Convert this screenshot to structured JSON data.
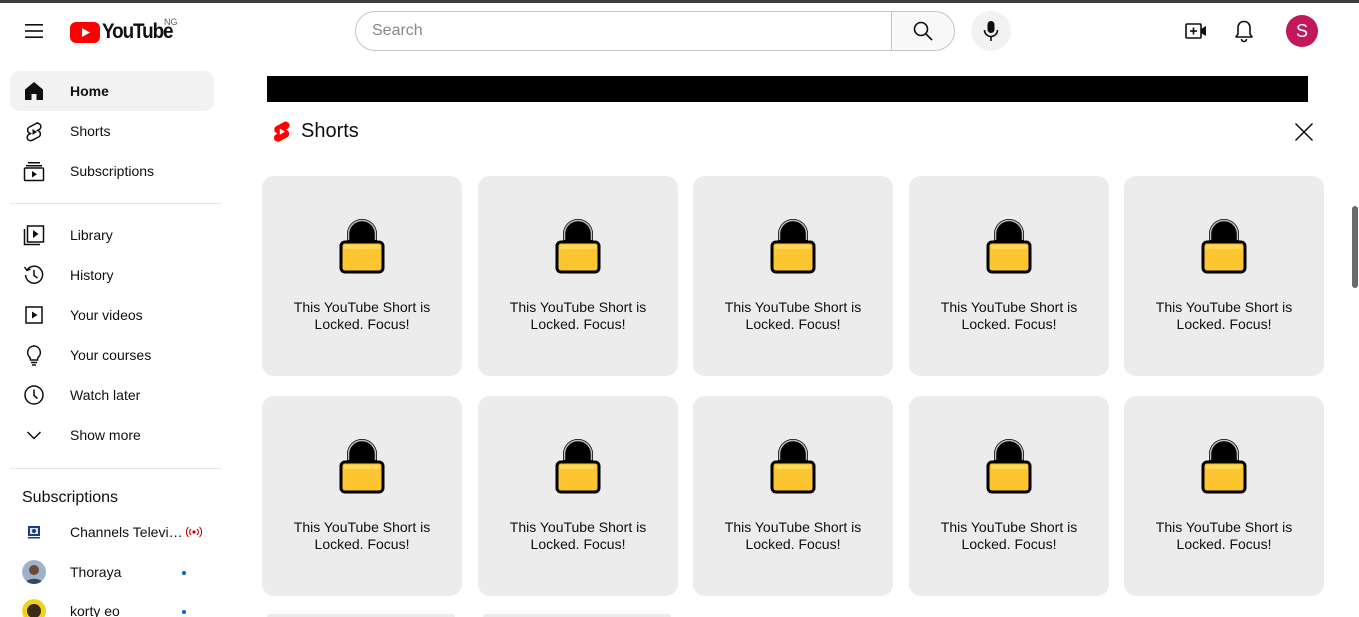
{
  "header": {
    "logo_text": "YouTube",
    "region": "NG",
    "search_placeholder": "Search",
    "avatar_letter": "S",
    "avatar_color": "#c2185b"
  },
  "sidebar": {
    "main": [
      {
        "label": "Home",
        "icon": "home-icon",
        "active": true
      },
      {
        "label": "Shorts",
        "icon": "shorts-icon"
      },
      {
        "label": "Subscriptions",
        "icon": "subscriptions-icon"
      }
    ],
    "library": [
      {
        "label": "Library",
        "icon": "library-icon"
      },
      {
        "label": "History",
        "icon": "history-icon"
      },
      {
        "label": "Your videos",
        "icon": "your-videos-icon"
      },
      {
        "label": "Your courses",
        "icon": "courses-icon"
      },
      {
        "label": "Watch later",
        "icon": "watch-later-icon"
      },
      {
        "label": "Show more",
        "icon": "chevron-down-icon"
      }
    ],
    "subscriptions_title": "Subscriptions",
    "subscriptions": [
      {
        "label": "Channels Television",
        "badge": "live"
      },
      {
        "label": "Thoraya",
        "badge": "new"
      },
      {
        "label": "korty eo",
        "badge": "new"
      }
    ]
  },
  "shorts": {
    "title": "Shorts",
    "cards": [
      {
        "line1": "This YouTube Short is",
        "line2": "Locked. Focus!"
      },
      {
        "line1": "This YouTube Short is",
        "line2": "Locked. Focus!"
      },
      {
        "line1": "This YouTube Short is",
        "line2": "Locked. Focus!"
      },
      {
        "line1": "This YouTube Short is",
        "line2": "Locked. Focus!"
      },
      {
        "line1": "This YouTube Short is",
        "line2": "Locked. Focus!"
      },
      {
        "line1": "This YouTube Short is",
        "line2": "Locked. Focus!"
      },
      {
        "line1": "This YouTube Short is",
        "line2": "Locked. Focus!"
      },
      {
        "line1": "This YouTube Short is",
        "line2": "Locked. Focus!"
      },
      {
        "line1": "This YouTube Short is",
        "line2": "Locked. Focus!"
      },
      {
        "line1": "This YouTube Short is",
        "line2": "Locked. Focus!"
      }
    ]
  },
  "colors": {
    "brand_red": "#ff0000",
    "lock_body": "#fdc52f",
    "card_bg": "#ececec",
    "new_dot": "#065fd4",
    "live": "#cc0000"
  }
}
